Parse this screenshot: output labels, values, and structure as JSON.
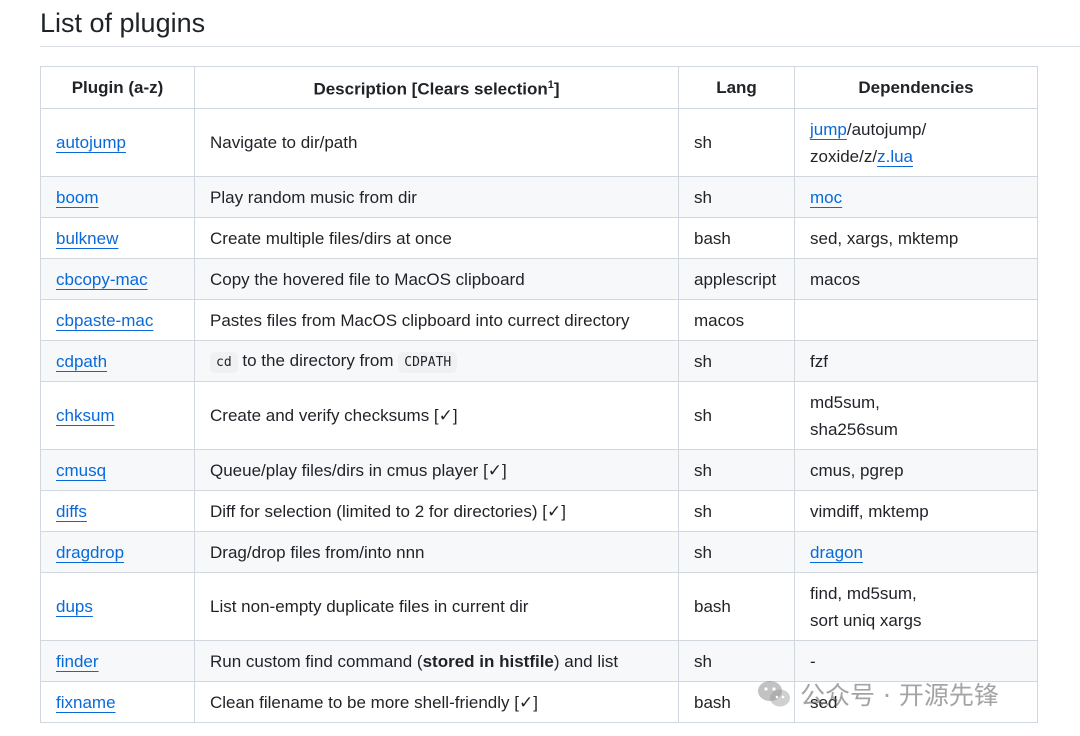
{
  "page_title": "List of plugins",
  "headers": {
    "plugin": "Plugin (a-z)",
    "description": "Description [Clears selection",
    "description_sup": "1",
    "description_tail": "]",
    "lang": "Lang",
    "dependencies": "Dependencies"
  },
  "rows": [
    {
      "name": "autojump",
      "description": "Navigate to dir/path",
      "lang": "sh",
      "deps": [
        {
          "text": "jump",
          "link": true
        },
        {
          "text": "/autojump/",
          "link": false
        },
        {
          "br": true
        },
        {
          "text": "zoxide/z/",
          "link": false
        },
        {
          "text": "z.lua",
          "link": true
        }
      ]
    },
    {
      "name": "boom",
      "description": "Play random music from dir",
      "lang": "sh",
      "deps": [
        {
          "text": "moc",
          "link": true
        }
      ]
    },
    {
      "name": "bulknew",
      "description": "Create multiple files/dirs at once",
      "lang": "bash",
      "deps": [
        {
          "text": "sed, xargs, mktemp",
          "link": false
        }
      ]
    },
    {
      "name": "cbcopy-mac",
      "description": "Copy the hovered file to MacOS clipboard",
      "lang": "applescript",
      "deps": [
        {
          "text": "macos",
          "link": false
        }
      ]
    },
    {
      "name": "cbpaste-mac",
      "description": "Pastes files from MacOS clipboard into currect directory",
      "lang": "macos",
      "deps": []
    },
    {
      "name": "cdpath",
      "desc_parts": [
        {
          "text": "cd",
          "code": true
        },
        {
          "text": " to the directory from "
        },
        {
          "text": "CDPATH",
          "code": true
        }
      ],
      "lang": "sh",
      "deps": [
        {
          "text": "fzf",
          "link": false
        }
      ]
    },
    {
      "name": "chksum",
      "description": "Create and verify checksums [✓]",
      "lang": "sh",
      "deps": [
        {
          "text": "md5sum,",
          "link": false
        },
        {
          "br": true
        },
        {
          "text": "sha256sum",
          "link": false
        }
      ]
    },
    {
      "name": "cmusq",
      "description": "Queue/play files/dirs in cmus player [✓]",
      "lang": "sh",
      "deps": [
        {
          "text": "cmus, pgrep",
          "link": false
        }
      ]
    },
    {
      "name": "diffs",
      "description": "Diff for selection (limited to 2 for directories) [✓]",
      "lang": "sh",
      "deps": [
        {
          "text": "vimdiff, mktemp",
          "link": false
        }
      ]
    },
    {
      "name": "dragdrop",
      "description": "Drag/drop files from/into nnn",
      "lang": "sh",
      "deps": [
        {
          "text": "dragon",
          "link": true
        }
      ]
    },
    {
      "name": "dups",
      "description": "List non-empty duplicate files in current dir",
      "lang": "bash",
      "deps": [
        {
          "text": "find, md5sum,",
          "link": false
        },
        {
          "br": true
        },
        {
          "text": "sort uniq xargs",
          "link": false
        }
      ]
    },
    {
      "name": "finder",
      "desc_parts": [
        {
          "text": "Run custom find command ("
        },
        {
          "text": "stored in histfile",
          "bold": true
        },
        {
          "text": ") and list"
        }
      ],
      "lang": "sh",
      "deps": [
        {
          "text": "-",
          "link": false
        }
      ]
    },
    {
      "name": "fixname",
      "description": "Clean filename to be more shell-friendly [✓]",
      "lang": "bash",
      "deps": [
        {
          "text": "sed",
          "link": false
        }
      ]
    }
  ],
  "watermark": {
    "text": "公众号 · 开源先锋",
    "icon": "wechat-icon"
  },
  "colors": {
    "link": "#0969da",
    "border": "#d0d7de",
    "stripe": "#f6f8fa",
    "text": "#1f2328"
  }
}
